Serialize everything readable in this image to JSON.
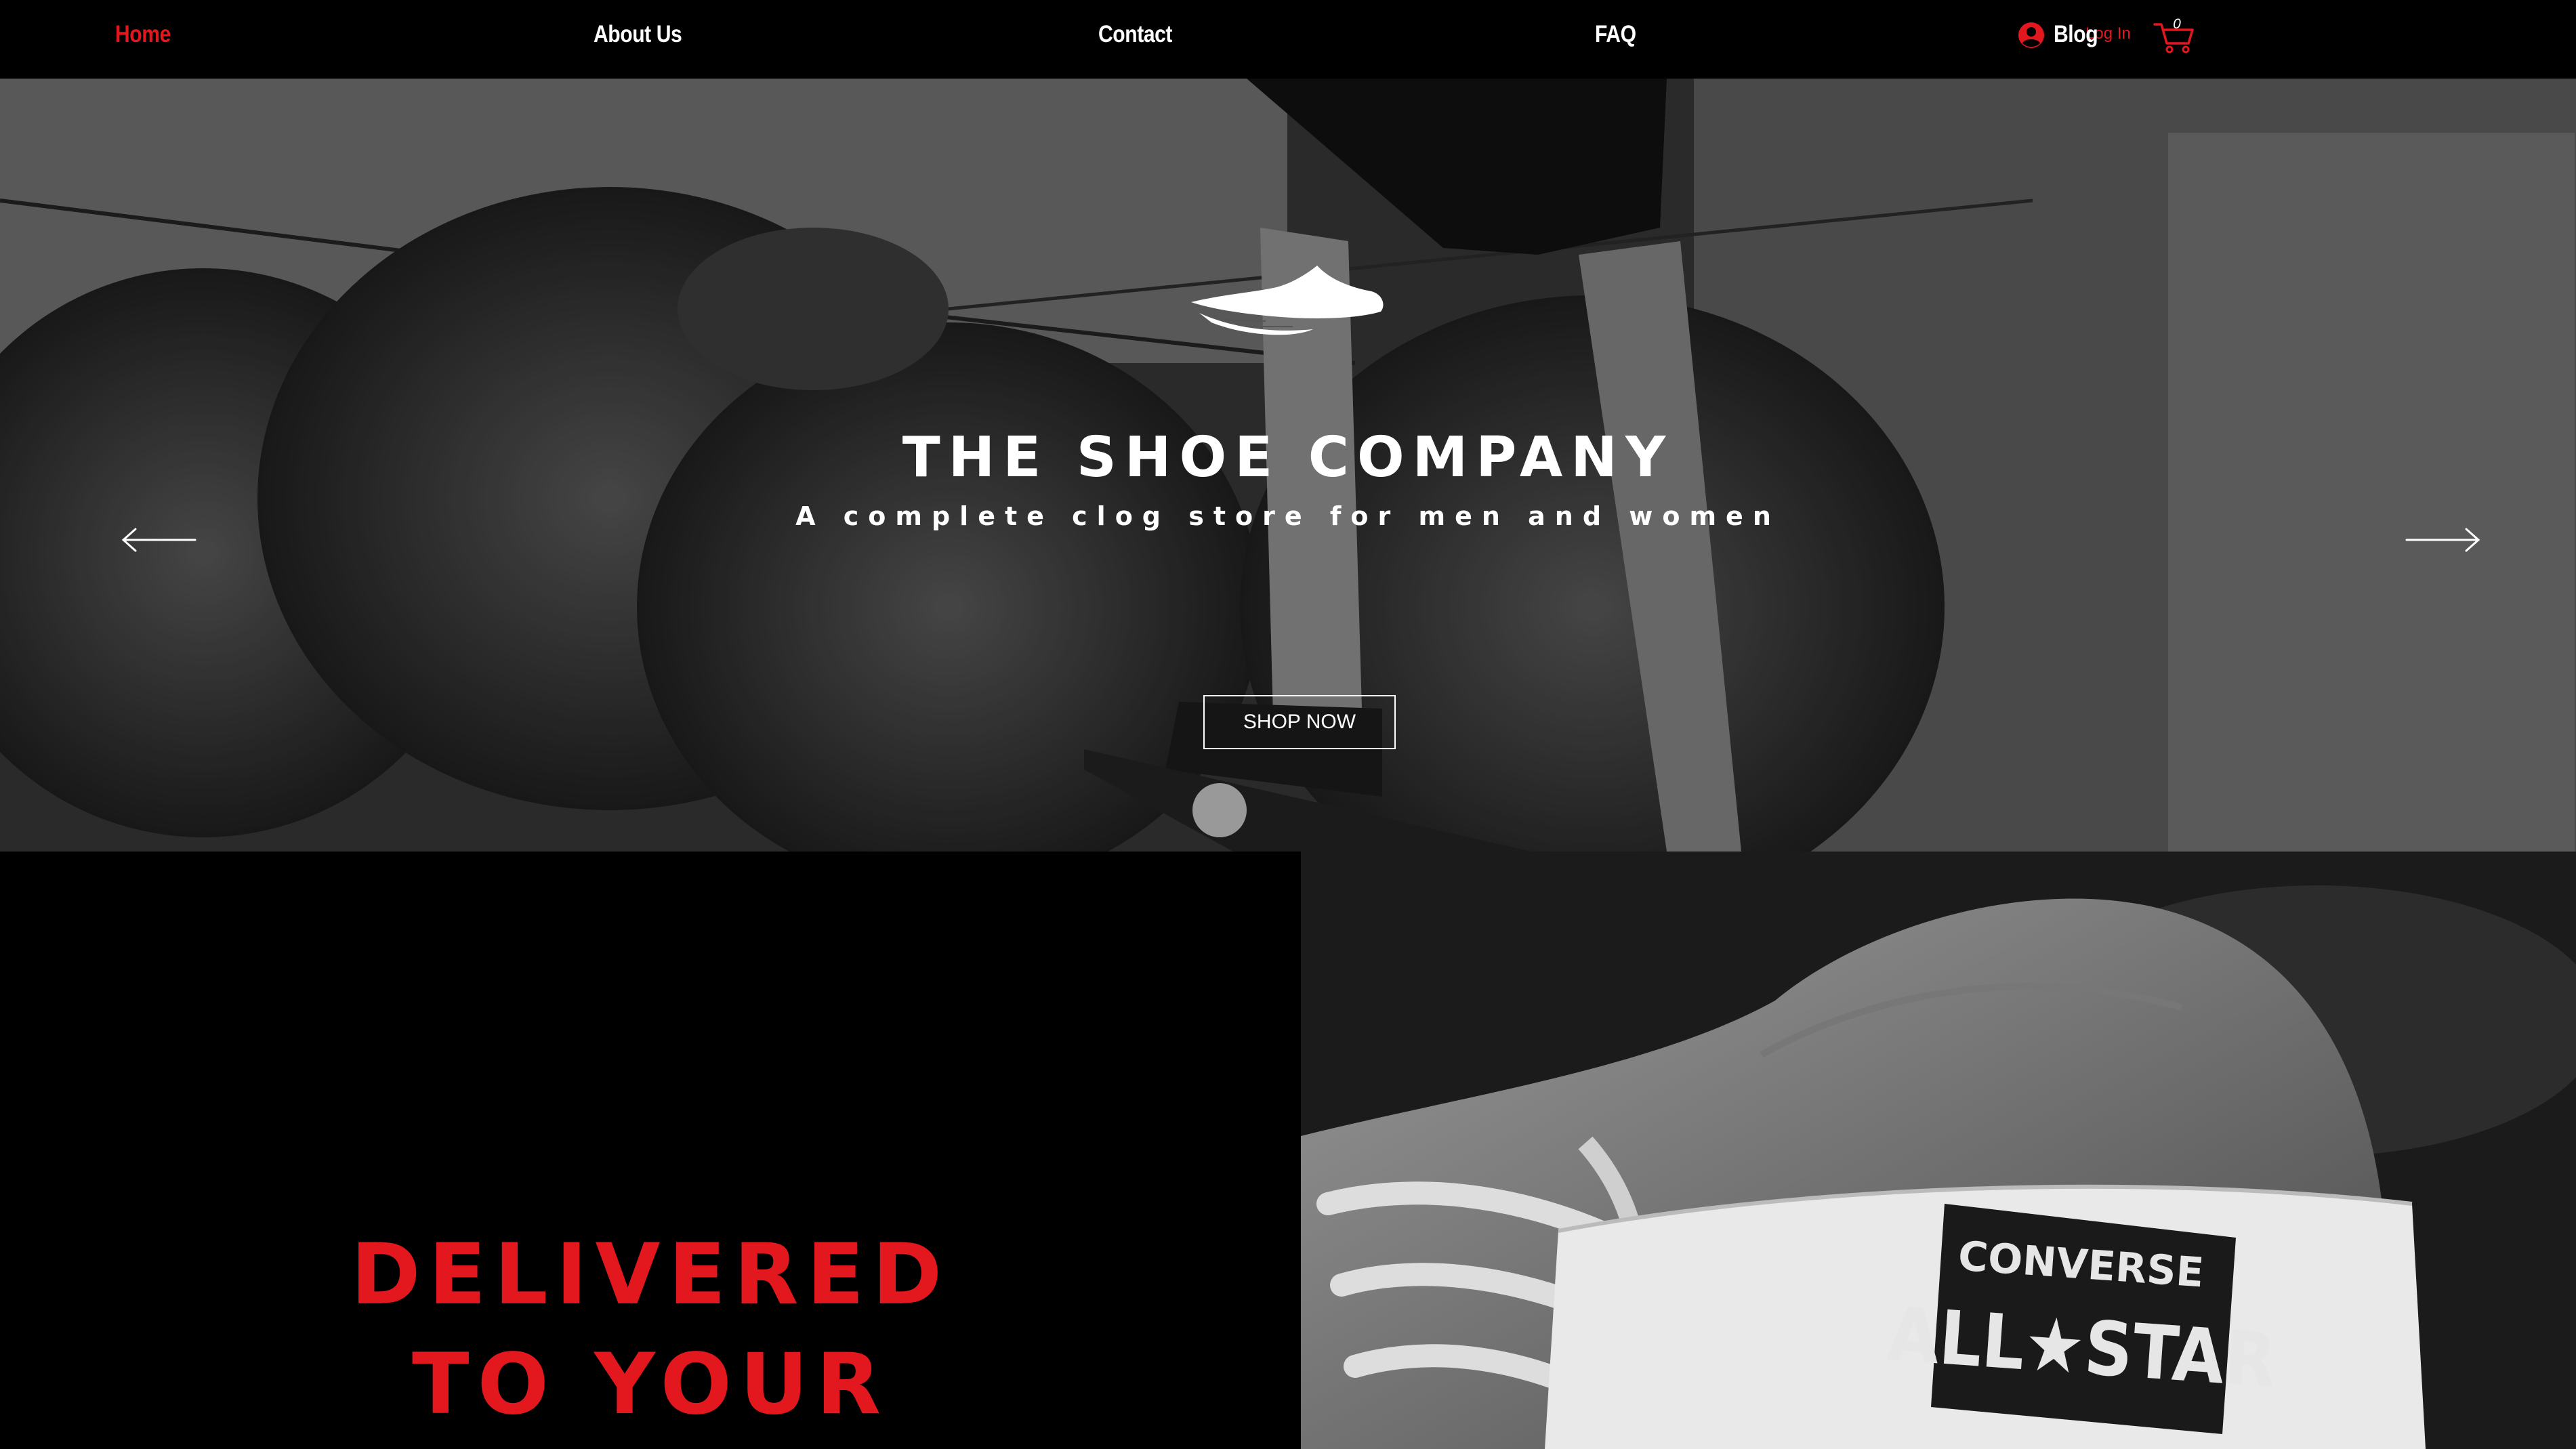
{
  "nav": {
    "items": [
      {
        "label": "Home",
        "active": true
      },
      {
        "label": "About Us",
        "active": false
      },
      {
        "label": "Contact",
        "active": false
      },
      {
        "label": "FAQ",
        "active": false
      },
      {
        "label": "Blog",
        "active": false
      }
    ],
    "login_label": "Log In",
    "cart_count": "0"
  },
  "hero": {
    "title": "THE SHOE COMPANY",
    "subtitle": "A complete clog store for men and women",
    "cta_label": "SHOP NOW",
    "slides_count": 3,
    "active_slide": 1
  },
  "promo": {
    "line1": "DELIVERED",
    "line2": "TO YOUR",
    "badge_line1": "CONVERSE",
    "badge_line2": "ALL★STAR"
  },
  "colors": {
    "accent": "#e3171e",
    "background": "#000000",
    "text": "#ffffff"
  },
  "icons": [
    "user-circle-icon",
    "cart-icon",
    "shoe-wing-logo",
    "arrow-left-icon",
    "arrow-right-icon"
  ]
}
